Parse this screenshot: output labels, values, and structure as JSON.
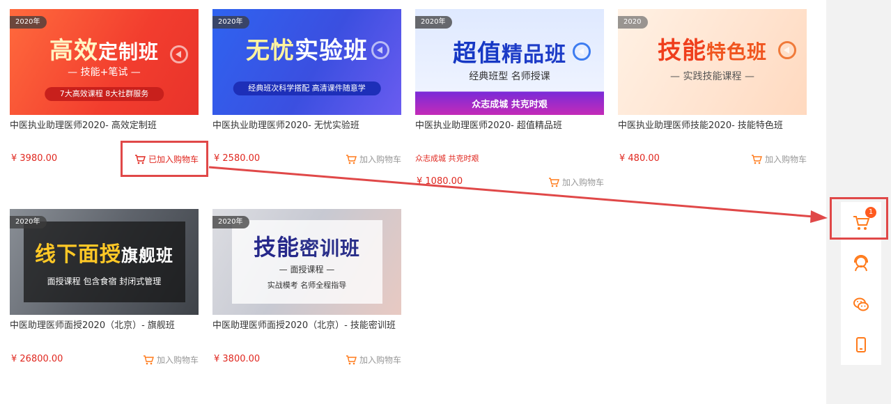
{
  "courses": [
    {
      "year": "2020年",
      "banner_title_a": "高效",
      "banner_title_b": "定制班",
      "banner_sub": "— 技能+笔试 —",
      "banner_pill": "7大高效课程 8大社群服务",
      "title": "中医执业助理医师2020- 高效定制班",
      "price": "¥ 3980.00",
      "cart_label": "已加入购物车",
      "added": true
    },
    {
      "year": "2020年",
      "banner_title_a": "无忧",
      "banner_title_b": "实验班",
      "banner_sub": "",
      "banner_pill": "经典班次科学搭配 高清课件随意学",
      "title": "中医执业助理医师2020- 无忧实验班",
      "price": "¥ 2580.00",
      "cart_label": "加入购物车",
      "added": false
    },
    {
      "year": "2020年",
      "banner_title_a": "超值",
      "banner_title_b": "精品班",
      "banner_sub": "经典班型 名师授课",
      "banner_pill": "众志成城 共克时艰",
      "title": "中医执业助理医师2020- 超值精品班",
      "slogan": "众志成城 共克时艰",
      "price": "¥ 1080.00",
      "cart_label": "加入购物车",
      "added": false
    },
    {
      "year": "2020",
      "banner_title_a": "技能",
      "banner_title_b": "特色班",
      "banner_sub": "— 实践技能课程 —",
      "banner_pill": "",
      "title": "中医执业助理医师技能2020- 技能特色班",
      "price": "¥ 480.00",
      "cart_label": "加入购物车",
      "added": false
    },
    {
      "year": "2020年",
      "banner_title_a": "线下面授",
      "banner_title_b": "旗舰班",
      "banner_sub": "",
      "banner_pill": "面授课程 包含食宿 封闭式管理",
      "title": "中医助理医师面授2020（北京）- 旗舰班",
      "price": "¥ 26800.00",
      "cart_label": "加入购物车",
      "added": false
    },
    {
      "year": "2020年",
      "banner_title_a": "技能",
      "banner_title_b": "密训班",
      "banner_sub": "— 面授课程 —",
      "banner_pill": "实战模考 名师全程指导",
      "title": "中医助理医师面授2020（北京）- 技能密训班",
      "price": "¥ 3800.00",
      "cart_label": "加入购物车",
      "added": false
    }
  ],
  "side": {
    "cart_count": "1",
    "icons": [
      "cart-icon",
      "headset-icon",
      "wechat-icon",
      "mobile-icon"
    ]
  },
  "colors": {
    "price": "#e0271f",
    "accent_orange": "#ff7a1a",
    "annotation": "#e04848"
  }
}
